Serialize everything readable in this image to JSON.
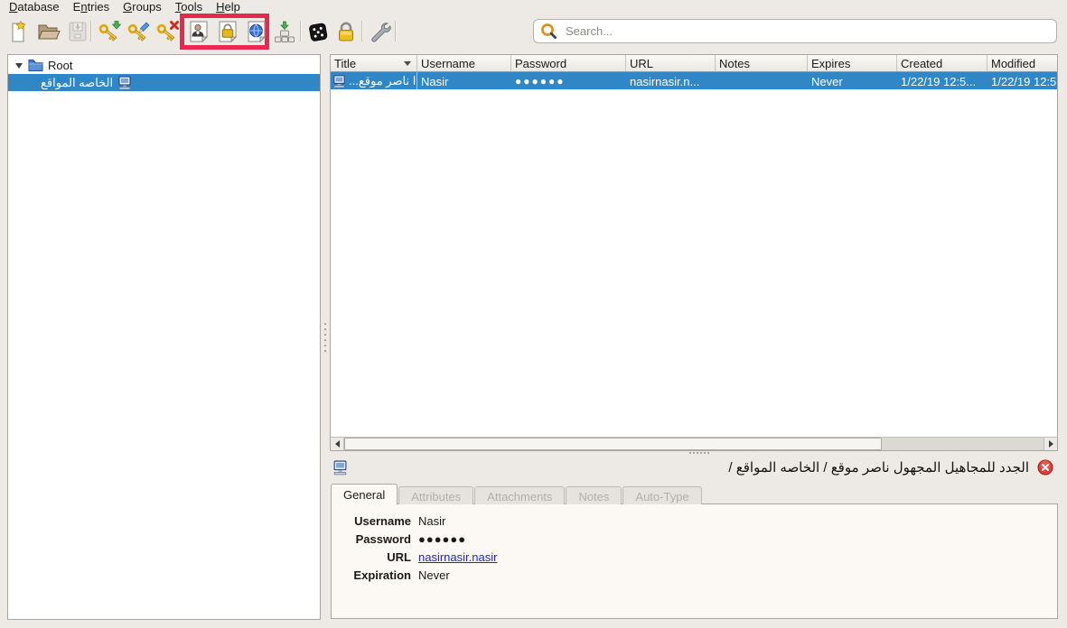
{
  "menu": {
    "items": [
      {
        "pre": "",
        "key": "D",
        "post": "atabase"
      },
      {
        "pre": "E",
        "key": "n",
        "post": "tries"
      },
      {
        "pre": "",
        "key": "G",
        "post": "roups"
      },
      {
        "pre": "",
        "key": "T",
        "post": "ools"
      },
      {
        "pre": "",
        "key": "H",
        "post": "elp"
      }
    ]
  },
  "toolbar": {
    "search_placeholder": "Search...",
    "buttons": [
      "new-database",
      "open-database",
      "save-database",
      "add-entry",
      "edit-entry",
      "delete-entry",
      "copy-username",
      "copy-password",
      "open-url",
      "perform-autotype",
      "password-generator",
      "lock-database",
      "settings"
    ],
    "annotation_color": "#e8284e"
  },
  "tree": {
    "root_label": "Root",
    "child_label": "المواقع‎ الخاصه"
  },
  "table": {
    "headers": [
      "Title",
      "Username",
      "Password",
      "URL",
      "Notes",
      "Expires",
      "Created",
      "Modified"
    ],
    "row": {
      "title": "...موقع‎ ناصر‎ ا",
      "username": "Nasir",
      "password_masked": "●●●●●●",
      "url": "nasirnasir.n...",
      "notes": "",
      "expires": "Never",
      "created": "1/22/19 12:5...",
      "modified": "1/22/19 12:5"
    }
  },
  "detail": {
    "breadcrumb": "/ المواقع‎ الخاصه‎ / موقع‎ ناصر‎ المجهول‎ للمجاهيل‎ الجدد",
    "tabs": [
      {
        "label": "General"
      },
      {
        "label": "Attributes"
      },
      {
        "label": "Attachments"
      },
      {
        "label": "Notes"
      },
      {
        "label": "Auto-Type"
      }
    ],
    "fields": [
      {
        "label": "Username",
        "value": "Nasir"
      },
      {
        "label": "Password",
        "value": "●●●●●●"
      },
      {
        "label": "URL",
        "value": "nasirnasir.nasir"
      },
      {
        "label": "Expiration",
        "value": "Never"
      }
    ]
  },
  "colors": {
    "selection_blue": "#3187c6",
    "annotation_red": "#e8284e",
    "link_blue": "#2424d6"
  }
}
